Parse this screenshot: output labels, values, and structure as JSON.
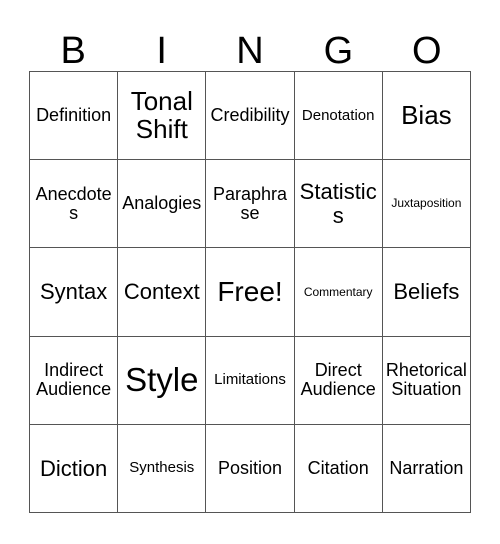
{
  "card": {
    "header_letters": [
      "B",
      "I",
      "N",
      "G",
      "O"
    ],
    "border_color": "#555555",
    "text_color": "#000000",
    "background_color": "#ffffff",
    "rows": [
      [
        {
          "label": "Definition",
          "size": "sm"
        },
        {
          "label": "Tonal Shift",
          "size": "lg"
        },
        {
          "label": "Credibility",
          "size": "sm"
        },
        {
          "label": "Denotation",
          "size": "xs"
        },
        {
          "label": "Bias",
          "size": "lg"
        }
      ],
      [
        {
          "label": "Anecdotes",
          "size": "sm"
        },
        {
          "label": "Analogies",
          "size": "sm"
        },
        {
          "label": "Paraphrase",
          "size": "sm"
        },
        {
          "label": "Statistics",
          "size": "md"
        },
        {
          "label": "Juxtaposition",
          "size": "xxs"
        }
      ],
      [
        {
          "label": "Syntax",
          "size": "md"
        },
        {
          "label": "Context",
          "size": "md"
        },
        {
          "label": "Free!",
          "size": "xl"
        },
        {
          "label": "Commentary",
          "size": "xxs"
        },
        {
          "label": "Beliefs",
          "size": "md"
        }
      ],
      [
        {
          "label": "Indirect Audience",
          "size": "sm"
        },
        {
          "label": "Style",
          "size": "xxl"
        },
        {
          "label": "Limitations",
          "size": "xs"
        },
        {
          "label": "Direct Audience",
          "size": "sm"
        },
        {
          "label": "Rhetorical Situation",
          "size": "sm"
        }
      ],
      [
        {
          "label": "Diction",
          "size": "md"
        },
        {
          "label": "Synthesis",
          "size": "xs"
        },
        {
          "label": "Position",
          "size": "sm"
        },
        {
          "label": "Citation",
          "size": "sm"
        },
        {
          "label": "Narration",
          "size": "sm"
        }
      ]
    ]
  }
}
